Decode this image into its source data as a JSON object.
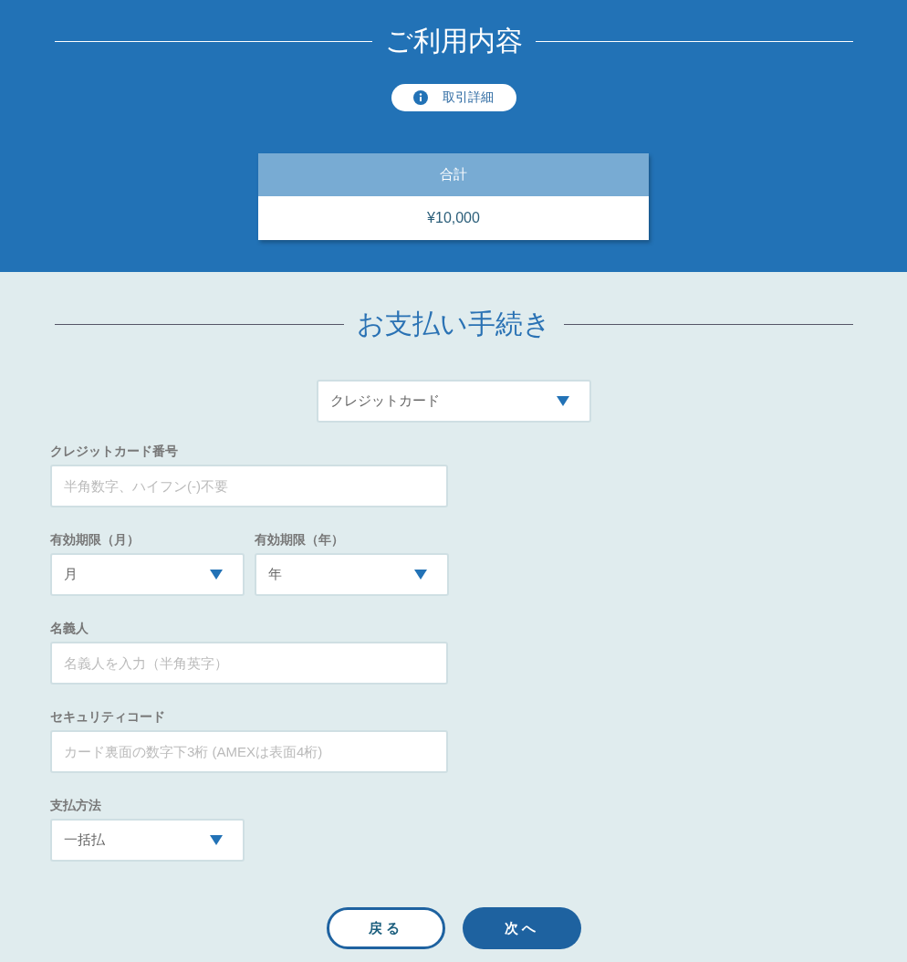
{
  "summary_section": {
    "title": "ご利用内容",
    "details_button": "取引詳細",
    "total": {
      "label": "合計",
      "value": "¥10,000"
    }
  },
  "payment_section": {
    "title": "お支払い手続き",
    "method_select": {
      "value": "クレジットカード"
    },
    "rows": [
      {
        "fields": [
          {
            "kind": "input",
            "label": "クレジットカード番号",
            "placeholder": "半角数字、ハイフン(-)不要"
          }
        ]
      },
      {
        "fields": [
          {
            "kind": "select",
            "label": "有効期限（月）",
            "value": "月"
          },
          {
            "kind": "select",
            "label": "有効期限（年）",
            "value": "年"
          }
        ]
      },
      {
        "fields": [
          {
            "kind": "input",
            "label": "名義人",
            "placeholder": "名義人を入力（半角英字）"
          }
        ]
      },
      {
        "fields": [
          {
            "kind": "input",
            "label": "セキュリティコード",
            "placeholder": "カード裏面の数字下3桁 (AMEXは表面4桁)"
          }
        ]
      },
      {
        "fields": [
          {
            "kind": "select",
            "label": "支払方法",
            "value": "一括払"
          }
        ]
      }
    ]
  },
  "buttons": [
    {
      "label": "戻る",
      "kind": "secondary"
    },
    {
      "label": "次へ",
      "kind": "primary"
    }
  ]
}
